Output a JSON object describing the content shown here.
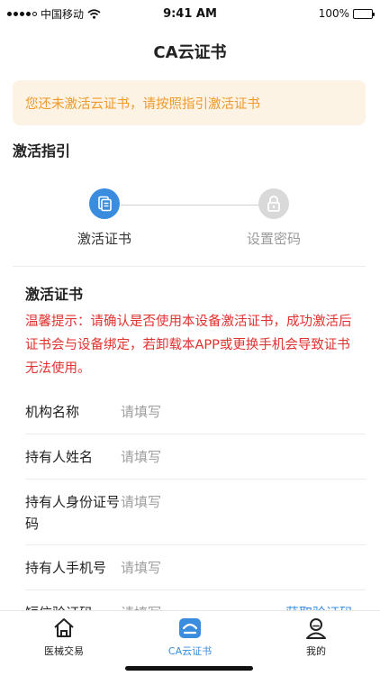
{
  "status_bar": {
    "carrier": "中国移动",
    "time": "9:41 AM",
    "battery": "100%",
    "battery_level": 1.0
  },
  "nav": {
    "title": "CA云证书"
  },
  "notice": {
    "text": "您还未激活云证书，请按照指引激活证书"
  },
  "guide": {
    "title": "激活指引",
    "steps": [
      {
        "label": "激活证书",
        "icon": "document-icon",
        "active": true
      },
      {
        "label": "设置密码",
        "icon": "lock-icon",
        "active": false
      }
    ]
  },
  "card": {
    "title": "激活证书",
    "warning": "温馨提示：请确认是否使用本设备激活证书，成功激活后证书会与设备绑定，若卸载本APP或更换手机会导致证书无法使用。"
  },
  "form": {
    "fields": [
      {
        "label": "机构名称",
        "placeholder": "请填写"
      },
      {
        "label": "持有人姓名",
        "placeholder": "请填写"
      },
      {
        "label": "持有人身份证号码",
        "placeholder": "请填写"
      },
      {
        "label": "持有人手机号",
        "placeholder": "请填写"
      },
      {
        "label": "短信验证码",
        "placeholder": "请填写"
      }
    ],
    "get_code_label": "获取验证码"
  },
  "tabbar": {
    "tabs": [
      {
        "label": "医械交易",
        "icon": "home-icon"
      },
      {
        "label": "CA云证书",
        "icon": "cloud-certificate-icon",
        "active": true
      },
      {
        "label": "我的",
        "icon": "user-icon"
      }
    ]
  },
  "colors": {
    "accent": "#3a8dde",
    "warning": "#e0322f",
    "notice_text": "#ef9a2b",
    "notice_bg": "#fdf3e4",
    "inactive": "#d9d9d9"
  }
}
